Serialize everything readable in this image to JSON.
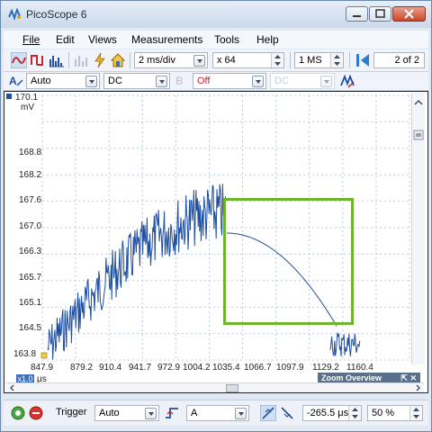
{
  "window": {
    "title": "PicoScope 6"
  },
  "menu": [
    "File",
    "Edit",
    "Views",
    "Measurements",
    "Tools",
    "Help"
  ],
  "toolbar1": {
    "timebase": "2 ms/div",
    "zoom": "x 64",
    "samples": "1 MS",
    "page": "2 of 2"
  },
  "toolbar2": {
    "channel": "A",
    "range": "Auto",
    "coupling": "DC",
    "channel_b_range": "Off",
    "channel_b_coupling": "DC"
  },
  "plot": {
    "y_unit": "mV",
    "y_ticks": [
      "170.1",
      "168.8",
      "168.2",
      "167.6",
      "167.0",
      "166.3",
      "165.7",
      "165.1",
      "164.5",
      "163.8"
    ],
    "x_ticks": [
      "847.9",
      "879.2",
      "910.4",
      "941.7",
      "972.9",
      "1004.2",
      "1035.4",
      "1066.7",
      "1097.9",
      "1129.2",
      "1160.4"
    ],
    "x_unit": "μs",
    "x_scale": "x1.0",
    "zoom_overview_label": "Zoom Overview",
    "trace_color": "#1f4fa0",
    "zoom_box_color": "#6fb52c"
  },
  "bottombar": {
    "trigger_label": "Trigger",
    "trigger_mode": "Auto",
    "trigger_channel": "A",
    "pre_trigger_time": "-265.5 μs",
    "percent": "50 %"
  }
}
